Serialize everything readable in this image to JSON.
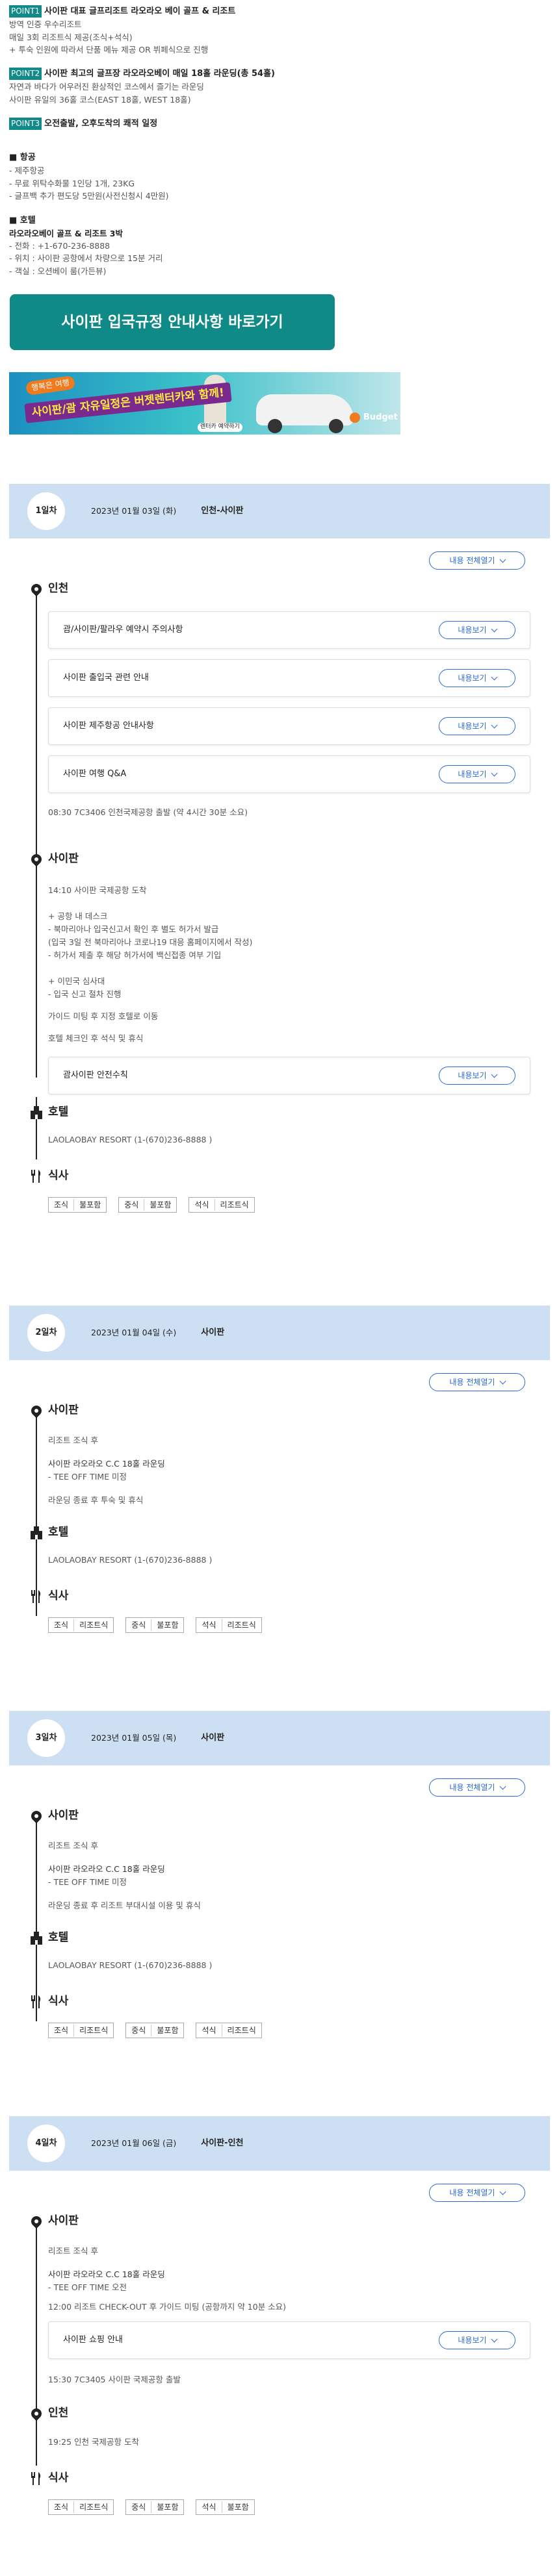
{
  "points": [
    {
      "badge": "POINT1",
      "title": "사이판 대표 글프리조트 라오라오 베이 골프 & 리조트",
      "lines": [
        "방역 인증 우수리조트",
        "매일 3회 리조트식 제공(조식+석식)",
        "+ 투숙 인원에 따라서 단품 메뉴 제공 OR 뷔페식으로 진행"
      ]
    },
    {
      "badge": "POINT2",
      "title": "사이판 최고의 글프장 라오라오베이 매일 18홀 라운딩(총 54홀)",
      "lines": [
        "자연과 바다가 어우러진 환상적인 코스에서 즐기는 라운딩",
        "사이판 유일의 36홀 코스(EAST 18홀, WEST 18홀)"
      ]
    },
    {
      "badge": "POINT3",
      "title": "오전출발, 오후도착의 쾌적 일정",
      "lines": []
    }
  ],
  "airline": {
    "head": "■ 항공",
    "name": "- 제주항공",
    "lines": [
      "- 무료 위탁수화물 1인당 1개, 23KG",
      "- 글프백 추가 편도당 5만원(사전신청시 4만원)"
    ]
  },
  "hotel": {
    "head": "■ 호텔",
    "name": "라오라오베이 골프 & 리조트 3박",
    "lines": [
      "- 전화 : +1-670-236-8888",
      "- 위치 : 사이판 공항에서 차량으로 15분 거리",
      "- 객실 : 오션베이 룸(가든뷰)"
    ]
  },
  "cta_label": "사이판 입국규정 안내사항 바로가기",
  "banner": {
    "tag": "행복은 여행",
    "copy": "사이판/괌 자유일정은 버젯렌터카와 함께!",
    "sub": "렌터카 예약하기",
    "brand": "Budget"
  },
  "expand_all": "내용 전체열기",
  "more": "내용보기",
  "days": [
    {
      "day": "1일차",
      "date": "2023년 01월 03일 (화)",
      "place": "인천-사이판",
      "incheon_title": "인천",
      "cards1": [
        "괌/사이판/팔라우 예약시 주의사항",
        "사이판 출입국 관련 안내",
        "사이판 제주항공 안내사항",
        "사이판 여행 Q&A"
      ],
      "flight": "08:30 7C3406 인천국제공항 출발 (약 4시간 30분 소요)",
      "saipan_title": "사이판",
      "s_lines": [
        "14:10 사이판 국제공항 도착",
        "+ 공항 내 데스크",
        "- 북마리아나 입국신고서 확인 후 별도 허가서 발급",
        "(입국 3일 전 북마리아나 코로나19 대응 홈페이지에서 작성)",
        "- 허가서 제출 후 해당 허가서에 백신접종 여부 기입",
        "+ 이민국 심사대",
        "- 입국 신고 절차 진행",
        "가이드 미팅 후 지정 호텔로 이동",
        "호텔 체크인 후 석식 및 휴식"
      ],
      "card2": "괌사이판 안전수칙",
      "hotel_title": "호텔",
      "hotel_line": "LAOLAOBAY RESORT (1-(670)236-8888 )",
      "meal_title": "식사",
      "meals": [
        [
          "조식",
          "불포함"
        ],
        [
          "중식",
          "불포함"
        ],
        [
          "석식",
          "리조트식"
        ]
      ]
    },
    {
      "day": "2일차",
      "date": "2023년 01월 04일 (수)",
      "place": "사이판",
      "saipan_title": "사이판",
      "s_lines": [
        "리조트 조식 후",
        "사이판 라오라오 C.C 18홀 라운딩",
        "- TEE OFF TIME 미정",
        "라운딩 종료 후 투숙 및 휴식"
      ],
      "hotel_title": "호텔",
      "hotel_line": "LAOLAOBAY RESORT (1-(670)236-8888 )",
      "meal_title": "식사",
      "meals": [
        [
          "조식",
          "리조트식"
        ],
        [
          "중식",
          "불포함"
        ],
        [
          "석식",
          "리조트식"
        ]
      ]
    },
    {
      "day": "3일차",
      "date": "2023년 01월 05일 (목)",
      "place": "사이판",
      "saipan_title": "사이판",
      "s_lines": [
        "리조트 조식 후",
        "사이판 라오라오 C.C 18홀 라운딩",
        "- TEE OFF TIME 미정",
        "라운딩 종료 후 리조트 부대시설 이용 및 휴식"
      ],
      "hotel_title": "호텔",
      "hotel_line": "LAOLAOBAY RESORT (1-(670)236-8888 )",
      "meal_title": "식사",
      "meals": [
        [
          "조식",
          "리조트식"
        ],
        [
          "중식",
          "불포함"
        ],
        [
          "석식",
          "리조트식"
        ]
      ]
    },
    {
      "day": "4일차",
      "date": "2023년 01월 06일 (금)",
      "place": "사이판-인천",
      "saipan_title": "사이판",
      "s_lines": [
        "리조트 조식 후",
        "사이판 라오라오 C.C 18홀 라운딩",
        "- TEE OFF TIME 오전",
        "12:00 리조트 CHECK-OUT 후 가이드 미팅 (공항까지 약 10분 소요)"
      ],
      "card": "사이판 쇼핑 안내",
      "depart": "15:30 7C3405 사이판 국제공항 출발",
      "incheon_title": "인천",
      "arrive": "19:25 인천 국제공항 도착",
      "meal_title": "식사",
      "meals": [
        [
          "조식",
          "리조트식"
        ],
        [
          "중식",
          "불포함"
        ],
        [
          "석식",
          "불포함"
        ]
      ]
    }
  ]
}
